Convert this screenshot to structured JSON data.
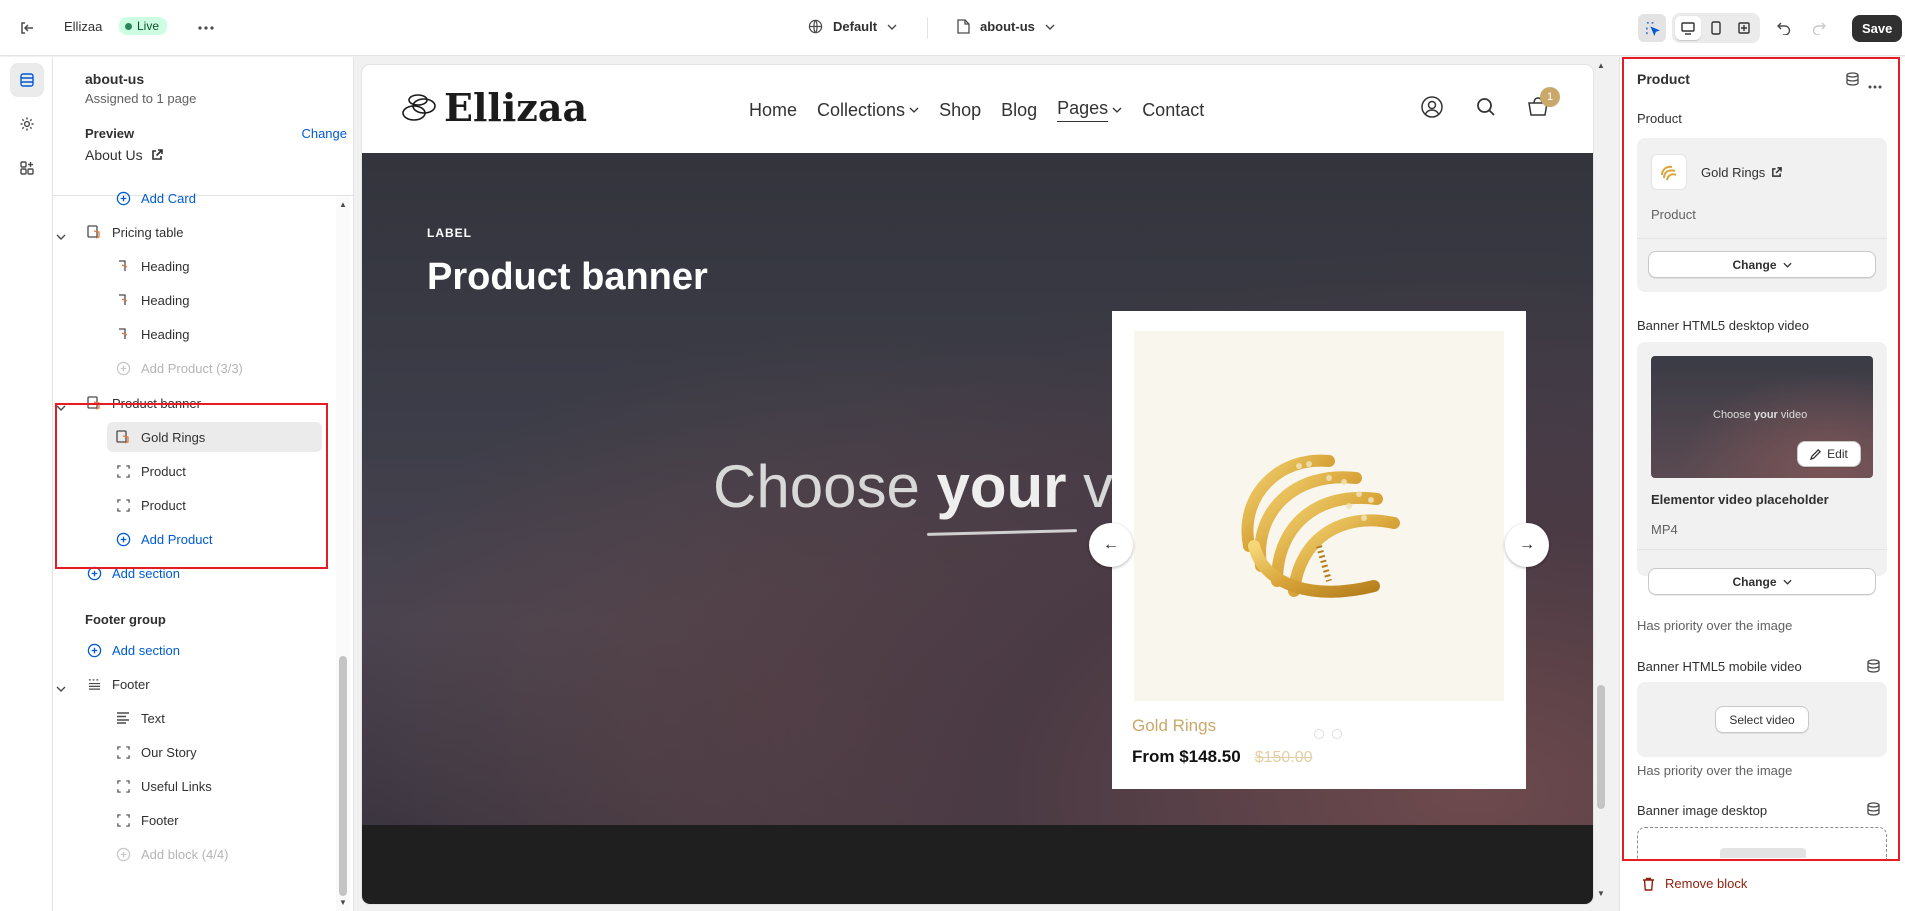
{
  "topbar": {
    "store_name": "Ellizaa",
    "status": "Live",
    "theme_select": "Default",
    "template_select": "about-us",
    "save_label": "Save"
  },
  "left": {
    "template_name": "about-us",
    "assigned": "Assigned to 1 page",
    "preview_label": "Preview",
    "change_label": "Change",
    "preview_page": "About Us",
    "tree": [
      {
        "label": "Add Card",
        "kind": "add"
      },
      {
        "label": "Pricing table",
        "kind": "section"
      },
      {
        "label": "Heading",
        "kind": "block"
      },
      {
        "label": "Heading",
        "kind": "block"
      },
      {
        "label": "Heading",
        "kind": "block"
      },
      {
        "label": "Add Product (3/3)",
        "kind": "add-disabled"
      },
      {
        "label": "Product banner",
        "kind": "section"
      },
      {
        "label": "Gold Rings",
        "kind": "block-selected"
      },
      {
        "label": "Product",
        "kind": "block"
      },
      {
        "label": "Product",
        "kind": "block"
      },
      {
        "label": "Add Product",
        "kind": "add"
      },
      {
        "label": "Add section",
        "kind": "add"
      },
      {
        "label": "Footer group",
        "kind": "group"
      },
      {
        "label": "Add section",
        "kind": "add"
      },
      {
        "label": "Footer",
        "kind": "section"
      },
      {
        "label": "Text",
        "kind": "block"
      },
      {
        "label": "Our Story",
        "kind": "block"
      },
      {
        "label": "Useful Links",
        "kind": "block"
      },
      {
        "label": "Footer",
        "kind": "block"
      },
      {
        "label": "Add block (4/4)",
        "kind": "add-disabled"
      }
    ]
  },
  "canvas": {
    "logo": "Ellizaa",
    "nav": [
      "Home",
      "Collections",
      "Shop",
      "Blog",
      "Pages",
      "Contact"
    ],
    "cart_count": "1",
    "banner_label": "LABEL",
    "banner_title": "Product banner",
    "video_text_a": "Choose ",
    "video_text_b": "your",
    "video_text_c": " v",
    "product_name": "Gold Rings",
    "price": "From $148.50",
    "compare_price": "$150.00"
  },
  "right": {
    "title": "Product",
    "product_label": "Product",
    "product_name": "Gold Rings",
    "product_type": "Product",
    "change_label": "Change",
    "desktop_video_label": "Banner HTML5 desktop video",
    "video_thumb_a": "Choose ",
    "video_thumb_b": "your",
    "video_thumb_c": " video",
    "edit_label": "Edit",
    "video_name": "Elementor video placeholder",
    "video_format": "MP4",
    "priority_note": "Has priority over the image",
    "mobile_video_label": "Banner HTML5 mobile video",
    "select_video": "Select video",
    "priority_note_2": "Has priority over the image",
    "image_desktop_label": "Banner image desktop",
    "remove_block": "Remove block"
  },
  "colors": {
    "accent": "#005bd3",
    "highlight": "#e51c23",
    "gold": "#c9a86a"
  }
}
